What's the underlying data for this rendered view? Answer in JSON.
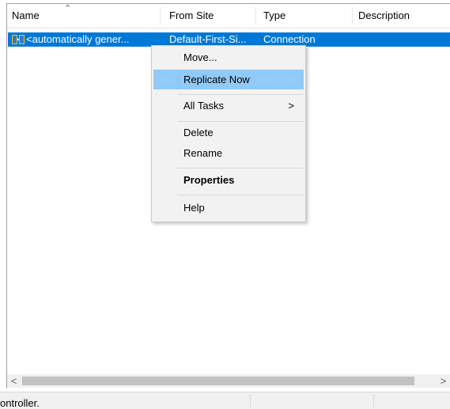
{
  "columns": [
    {
      "label": "Name"
    },
    {
      "label": "From Site"
    },
    {
      "label": "Type"
    },
    {
      "label": "Description"
    }
  ],
  "selected_row": {
    "name": "<automatically gener...",
    "from_site": "Default-First-Si...",
    "type": "Connection",
    "description": ""
  },
  "context_menu": {
    "move": "Move...",
    "replicate_now": "Replicate Now",
    "all_tasks": "All Tasks",
    "delete": "Delete",
    "rename": "Rename",
    "properties": "Properties",
    "help": "Help",
    "submenu_arrow": ">"
  },
  "scrollbar": {
    "left_arrow": "<",
    "right_arrow": ">"
  },
  "status": {
    "text": "ontroller."
  },
  "colors": {
    "selection": "#0078d7",
    "menu_highlight": "#91c9f7",
    "menu_bg": "#f2f2f2"
  },
  "icons": {
    "sort": "sort-ascending-caret",
    "row": "connection-icon",
    "submenu": "chevron-right"
  }
}
